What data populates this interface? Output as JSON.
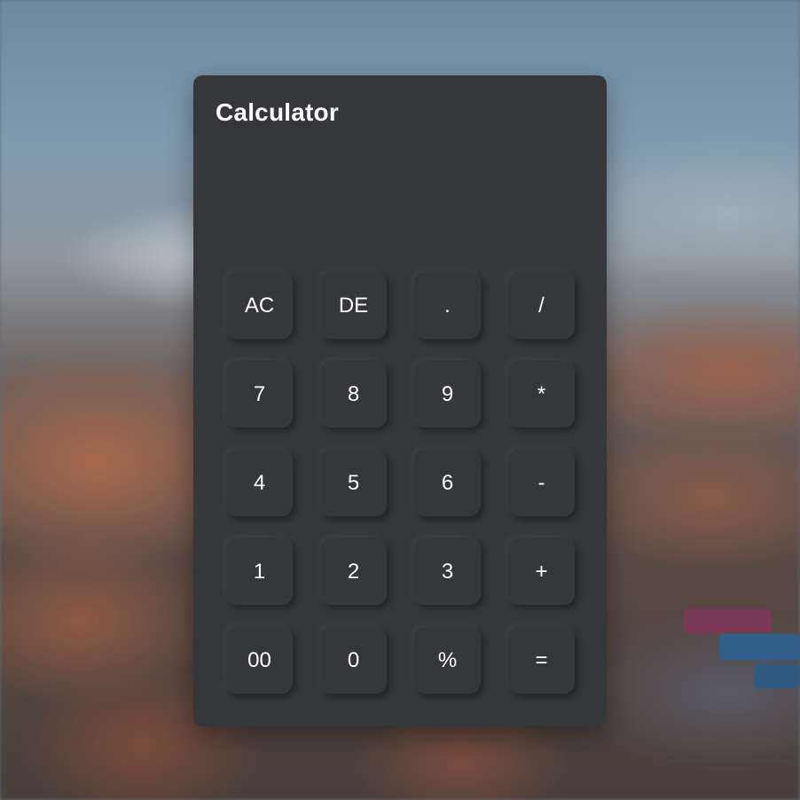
{
  "app": {
    "title": "Calculator",
    "display_value": ""
  },
  "keypad": {
    "rows": [
      [
        "AC",
        "DE",
        ".",
        "/"
      ],
      [
        "7",
        "8",
        "9",
        "*"
      ],
      [
        "4",
        "5",
        "6",
        "-"
      ],
      [
        "1",
        "2",
        "3",
        "+"
      ],
      [
        "00",
        "0",
        "%",
        "="
      ]
    ]
  },
  "theme": {
    "panel_color": "#35373b",
    "text_color": "#ffffff"
  }
}
